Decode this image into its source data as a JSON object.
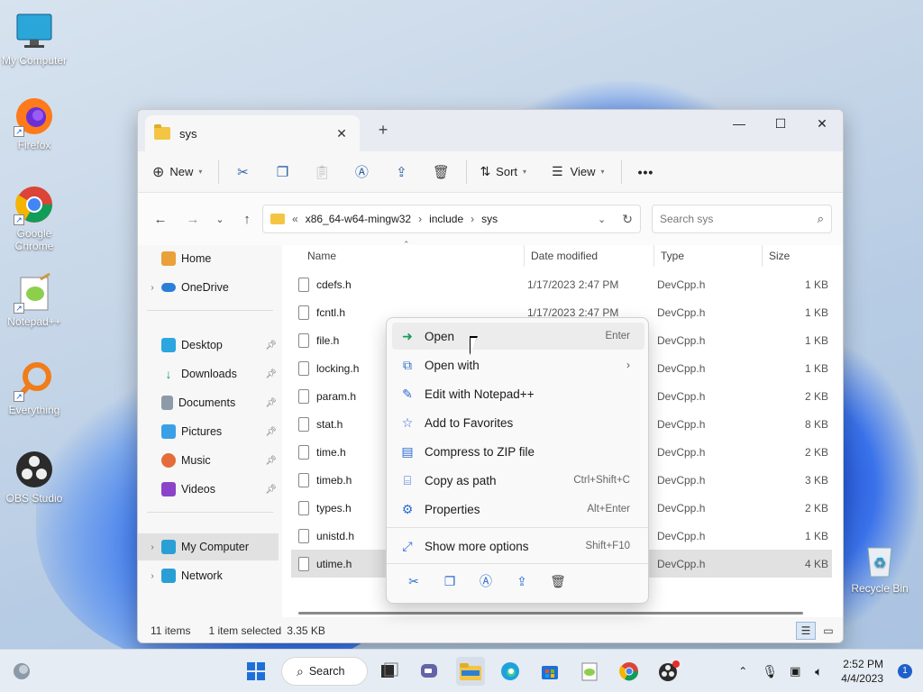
{
  "desktop": {
    "icons": [
      {
        "label": "My Computer",
        "icon": "monitor-icon"
      },
      {
        "label": "Firefox",
        "icon": "firefox-icon"
      },
      {
        "label": "Google Chrome",
        "icon": "chrome-icon"
      },
      {
        "label": "Notepad++",
        "icon": "notepadpp-icon"
      },
      {
        "label": "Everything",
        "icon": "everything-icon"
      },
      {
        "label": "OBS Studio",
        "icon": "obs-icon"
      },
      {
        "label": "Recycle Bin",
        "icon": "recycle-bin-icon"
      }
    ]
  },
  "window": {
    "tab_title": "sys",
    "new_tab": "+",
    "toolbar": {
      "new_label": "New",
      "sort_label": "Sort",
      "view_label": "View",
      "more": "•••"
    },
    "breadcrumb": {
      "overflow": "«",
      "items": [
        "x86_64-w64-mingw32",
        "include",
        "sys"
      ]
    },
    "search_placeholder": "Search sys",
    "sidebar": {
      "home": "Home",
      "onedrive": "OneDrive",
      "desktop": "Desktop",
      "downloads": "Downloads",
      "documents": "Documents",
      "pictures": "Pictures",
      "music": "Music",
      "videos": "Videos",
      "my_computer": "My Computer",
      "network": "Network"
    },
    "columns": {
      "name": "Name",
      "date": "Date modified",
      "type": "Type",
      "size": "Size"
    },
    "files": [
      {
        "name": "cdefs.h",
        "date": "1/17/2023 2:47 PM",
        "type": "DevCpp.h",
        "size": "1 KB"
      },
      {
        "name": "fcntl.h",
        "date": "1/17/2023 2:47 PM",
        "type": "DevCpp.h",
        "size": "1 KB"
      },
      {
        "name": "file.h",
        "date": "",
        "type": "DevCpp.h",
        "size": "1 KB"
      },
      {
        "name": "locking.h",
        "date": "",
        "type": "DevCpp.h",
        "size": "1 KB"
      },
      {
        "name": "param.h",
        "date": "",
        "type": "DevCpp.h",
        "size": "2 KB"
      },
      {
        "name": "stat.h",
        "date": "",
        "type": "DevCpp.h",
        "size": "8 KB"
      },
      {
        "name": "time.h",
        "date": "",
        "type": "DevCpp.h",
        "size": "2 KB"
      },
      {
        "name": "timeb.h",
        "date": "",
        "type": "DevCpp.h",
        "size": "3 KB"
      },
      {
        "name": "types.h",
        "date": "",
        "type": "DevCpp.h",
        "size": "2 KB"
      },
      {
        "name": "unistd.h",
        "date": "",
        "type": "DevCpp.h",
        "size": "1 KB"
      },
      {
        "name": "utime.h",
        "date": "",
        "type": "DevCpp.h",
        "size": "4 KB"
      }
    ],
    "status": {
      "items": "11 items",
      "selected": "1 item selected",
      "size": "3.35 KB"
    }
  },
  "context_menu": {
    "items": [
      {
        "label": "Open",
        "shortcut": "Enter"
      },
      {
        "label": "Open with",
        "shortcut": ""
      },
      {
        "label": "Edit with Notepad++",
        "shortcut": ""
      },
      {
        "label": "Add to Favorites",
        "shortcut": ""
      },
      {
        "label": "Compress to ZIP file",
        "shortcut": ""
      },
      {
        "label": "Copy as path",
        "shortcut": "Ctrl+Shift+C"
      },
      {
        "label": "Properties",
        "shortcut": "Alt+Enter"
      },
      {
        "label": "Show more options",
        "shortcut": "Shift+F10"
      }
    ]
  },
  "taskbar": {
    "search_label": "Search",
    "time": "2:52 PM",
    "date": "4/4/2023",
    "notification_count": "1"
  },
  "colors": {
    "accent": "#1f5fcc",
    "folder": "#f4c542",
    "selection": "#e1e1e1"
  }
}
